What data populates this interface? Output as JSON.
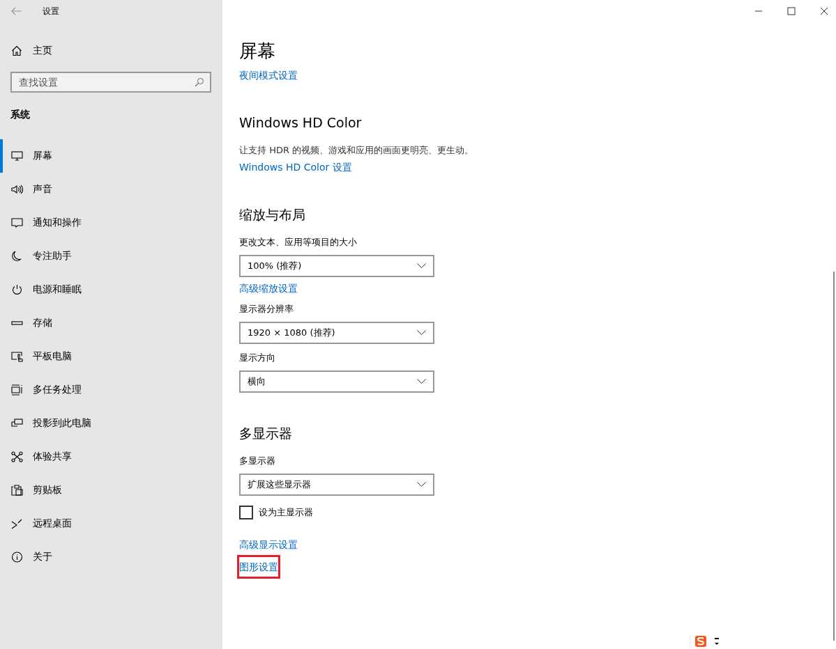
{
  "window": {
    "title": "设置"
  },
  "sidebar": {
    "home": "主页",
    "search": {
      "placeholder": "查找设置"
    },
    "section": "系统",
    "items": [
      {
        "label": "屏幕",
        "selected": true
      },
      {
        "label": "声音",
        "selected": false
      },
      {
        "label": "通知和操作",
        "selected": false
      },
      {
        "label": "专注助手",
        "selected": false
      },
      {
        "label": "电源和睡眠",
        "selected": false
      },
      {
        "label": "存储",
        "selected": false
      },
      {
        "label": "平板电脑",
        "selected": false
      },
      {
        "label": "多任务处理",
        "selected": false
      },
      {
        "label": "投影到此电脑",
        "selected": false
      },
      {
        "label": "体验共享",
        "selected": false
      },
      {
        "label": "剪贴板",
        "selected": false
      },
      {
        "label": "远程桌面",
        "selected": false
      },
      {
        "label": "关于",
        "selected": false
      }
    ]
  },
  "main": {
    "title": "屏幕",
    "sections": [
      {
        "items": [
          {
            "kind": "link",
            "text": "夜间模式设置",
            "highlighted": false
          }
        ]
      },
      {
        "title": "Windows HD Color",
        "items": [
          {
            "kind": "text",
            "text": "让支持 HDR 的视频、游戏和应用的画面更明亮、更生动。"
          },
          {
            "kind": "link",
            "text": "Windows HD Color 设置",
            "highlighted": false
          }
        ]
      },
      {
        "title": "缩放与布局",
        "items": [
          {
            "kind": "label",
            "text": "更改文本、应用等项目的大小"
          },
          {
            "kind": "dropdown",
            "text": "100% (推荐)"
          },
          {
            "kind": "link",
            "text": "高级缩放设置",
            "highlighted": false
          },
          {
            "kind": "label",
            "text": "显示器分辨率"
          },
          {
            "kind": "dropdown",
            "text": "1920 × 1080 (推荐)"
          },
          {
            "kind": "label",
            "text": "显示方向"
          },
          {
            "kind": "dropdown",
            "text": "横向"
          }
        ]
      },
      {
        "title": "多显示器",
        "items": [
          {
            "kind": "label",
            "text": "多显示器"
          },
          {
            "kind": "dropdown",
            "text": "扩展这些显示器"
          },
          {
            "kind": "checkbox",
            "text": "设为主显示器",
            "checked": false
          },
          {
            "kind": "link",
            "text": "高级显示设置",
            "highlighted": false
          },
          {
            "kind": "link",
            "text": "图形设置",
            "highlighted": true
          }
        ]
      }
    ]
  }
}
